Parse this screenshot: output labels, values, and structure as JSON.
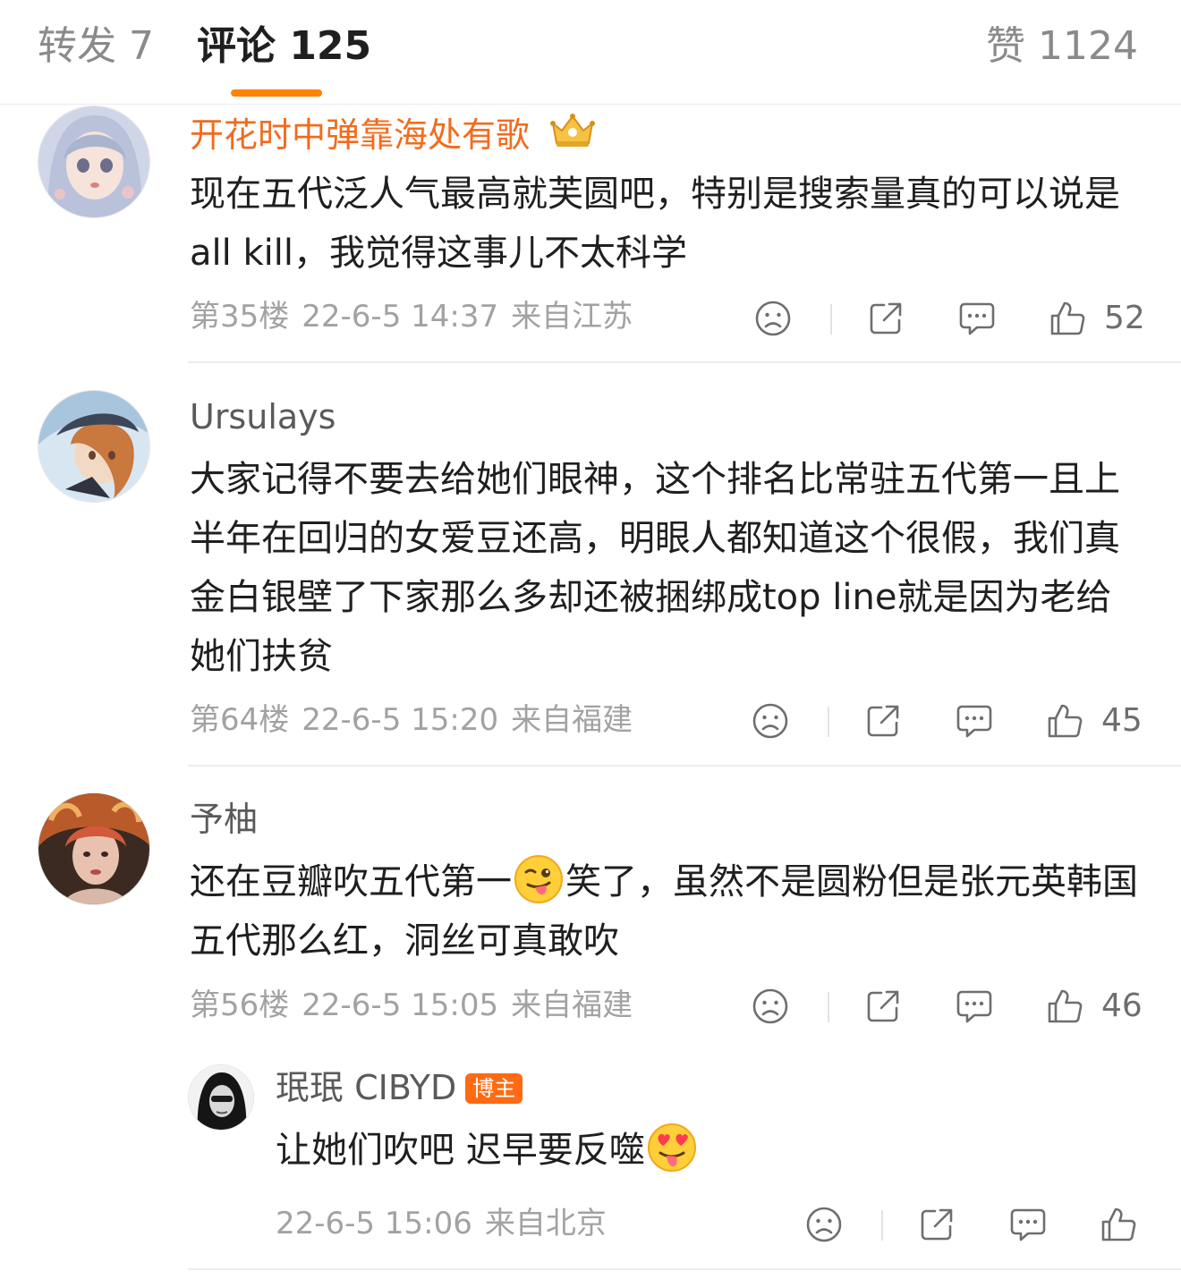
{
  "tabs": {
    "repost": "转发 7",
    "comments": "评论 125",
    "likes": "赞 1124"
  },
  "colors": {
    "accent": "#ff8200",
    "vip_name": "#f26b1d",
    "badge": "#ff6a13"
  },
  "comments": [
    {
      "username": "开花时中弹靠海处有歌",
      "username_icon": "crown-badge-icon",
      "text": "现在五代泛人气最高就芙圆吧，特别是搜索量真的可以说是all kill，我觉得这事儿不太科学",
      "floor": "第35楼",
      "time": "22-6-5 14:37",
      "location": "来自江苏",
      "likes": "52"
    },
    {
      "username": "Ursulays",
      "text": "大家记得不要去给她们眼神，这个排名比常驻五代第一且上半年在回归的女爱豆还高，明眼人都知道这个很假，我们真金白银壁了下家那么多却还被捆绑成top line就是因为老给她们扶贫",
      "floor": "第64楼",
      "time": "22-6-5 15:20",
      "location": "来自福建",
      "likes": "45"
    },
    {
      "username": "予柚",
      "text_before_emoji": "还在豆瓣吹五代第一",
      "emoji": "tongue-out-emoji",
      "text_after_emoji": "笑了，虽然不是圆粉但是张元英韩国五代那么红，洞丝可真敢吹",
      "floor": "第56楼",
      "time": "22-6-5 15:05",
      "location": "来自福建",
      "likes": "46"
    }
  ],
  "reply": {
    "username": "珉珉 CIBYD",
    "badge": "博主",
    "text": "让她们吹吧 迟早要反噬",
    "emoji": "heart-eyes-tongue-emoji",
    "time": "22-6-5 15:06",
    "location": "来自北京"
  }
}
